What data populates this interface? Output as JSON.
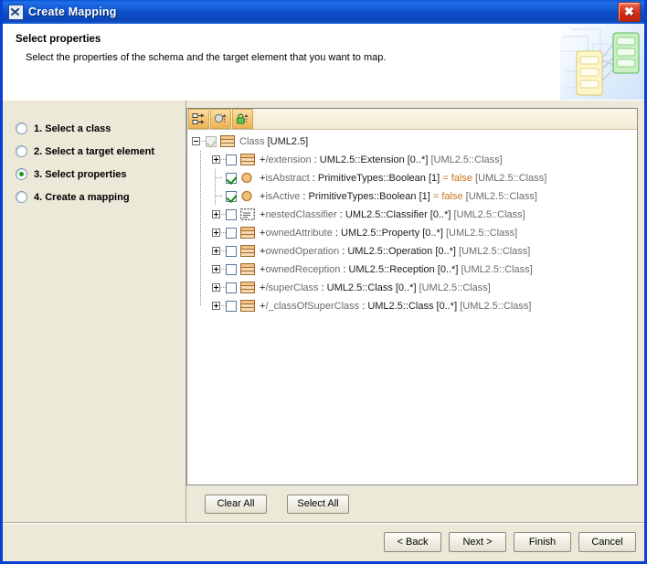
{
  "window": {
    "title": "Create Mapping",
    "icon": "app-icon",
    "close_label": "✖"
  },
  "banner": {
    "title": "Select properties",
    "subtitle": "Select the properties of the schema and the target element that you want to map."
  },
  "steps": [
    {
      "label": "1. Select a class",
      "selected": false
    },
    {
      "label": "2. Select a target element",
      "selected": false
    },
    {
      "label": "3. Select properties",
      "selected": true
    },
    {
      "label": "4. Create a mapping",
      "selected": false
    }
  ],
  "toolbar": {
    "buttons": [
      {
        "name": "show-derived-button",
        "tooltip": "Show derived"
      },
      {
        "name": "show-inherited-button",
        "tooltip": "Show inherited"
      },
      {
        "name": "show-visibility-button",
        "tooltip": "Show visibility"
      }
    ]
  },
  "tree": {
    "rows": [
      {
        "depth": 0,
        "twisty": "minus",
        "checkbox": "dim-checked",
        "icon": "class-icon",
        "prefix": "",
        "name": "Class",
        "rest": " [UML2.5]",
        "value": "",
        "suffix": ""
      },
      {
        "depth": 1,
        "twisty": "plus",
        "checkbox": "unchecked",
        "icon": "class-icon",
        "prefix": "+",
        "name": "/extension",
        "rest": " : UML2.5::Extension [0..*]",
        "value": "",
        "suffix": " [UML2.5::Class]"
      },
      {
        "depth": 1,
        "twisty": "none",
        "checkbox": "checked",
        "icon": "attribute-icon",
        "prefix": "+",
        "name": "isAbstract",
        "rest": " : PrimitiveTypes::Boolean [1] ",
        "value": "= false",
        "suffix": " [UML2.5::Class]"
      },
      {
        "depth": 1,
        "twisty": "none",
        "checkbox": "checked",
        "icon": "attribute-icon",
        "prefix": "+",
        "name": "isActive",
        "rest": " : PrimitiveTypes::Boolean [1] ",
        "value": "= false",
        "suffix": " [UML2.5::Class]"
      },
      {
        "depth": 1,
        "twisty": "plus",
        "checkbox": "unchecked",
        "icon": "abstract-classifier-icon",
        "prefix": "+",
        "name": "nestedClassifier",
        "rest": " : UML2.5::Classifier [0..*]",
        "value": "",
        "suffix": " [UML2.5::Class]"
      },
      {
        "depth": 1,
        "twisty": "plus",
        "checkbox": "unchecked",
        "icon": "class-icon",
        "prefix": "+",
        "name": "ownedAttribute",
        "rest": " : UML2.5::Property [0..*]",
        "value": "",
        "suffix": " [UML2.5::Class]"
      },
      {
        "depth": 1,
        "twisty": "plus",
        "checkbox": "unchecked",
        "icon": "class-icon",
        "prefix": "+",
        "name": "ownedOperation",
        "rest": " : UML2.5::Operation [0..*]",
        "value": "",
        "suffix": " [UML2.5::Class]"
      },
      {
        "depth": 1,
        "twisty": "plus",
        "checkbox": "unchecked",
        "icon": "class-icon",
        "prefix": "+",
        "name": "ownedReception",
        "rest": " : UML2.5::Reception [0..*]",
        "value": "",
        "suffix": " [UML2.5::Class]"
      },
      {
        "depth": 1,
        "twisty": "plus",
        "checkbox": "unchecked",
        "icon": "class-icon",
        "prefix": "+",
        "name": "/superClass",
        "rest": " : UML2.5::Class [0..*]",
        "value": "",
        "suffix": " [UML2.5::Class]"
      },
      {
        "depth": 1,
        "twisty": "plus",
        "checkbox": "unchecked",
        "icon": "class-icon",
        "prefix": "+",
        "name": "/_classOfSuperClass",
        "rest": " : UML2.5::Class [0..*]",
        "value": "",
        "suffix": " [UML2.5::Class]"
      }
    ]
  },
  "selection_buttons": {
    "clear_all": "Clear All",
    "select_all": "Select All"
  },
  "footer": {
    "back": "< Back",
    "next": "Next >",
    "finish": "Finish",
    "cancel": "Cancel"
  },
  "colors": {
    "titlebar_blue": "#0c4ec9",
    "dialog_bg": "#ece9d8",
    "accent_orange": "#c8741c",
    "check_green": "#158a15",
    "close_red": "#cf2c15"
  }
}
